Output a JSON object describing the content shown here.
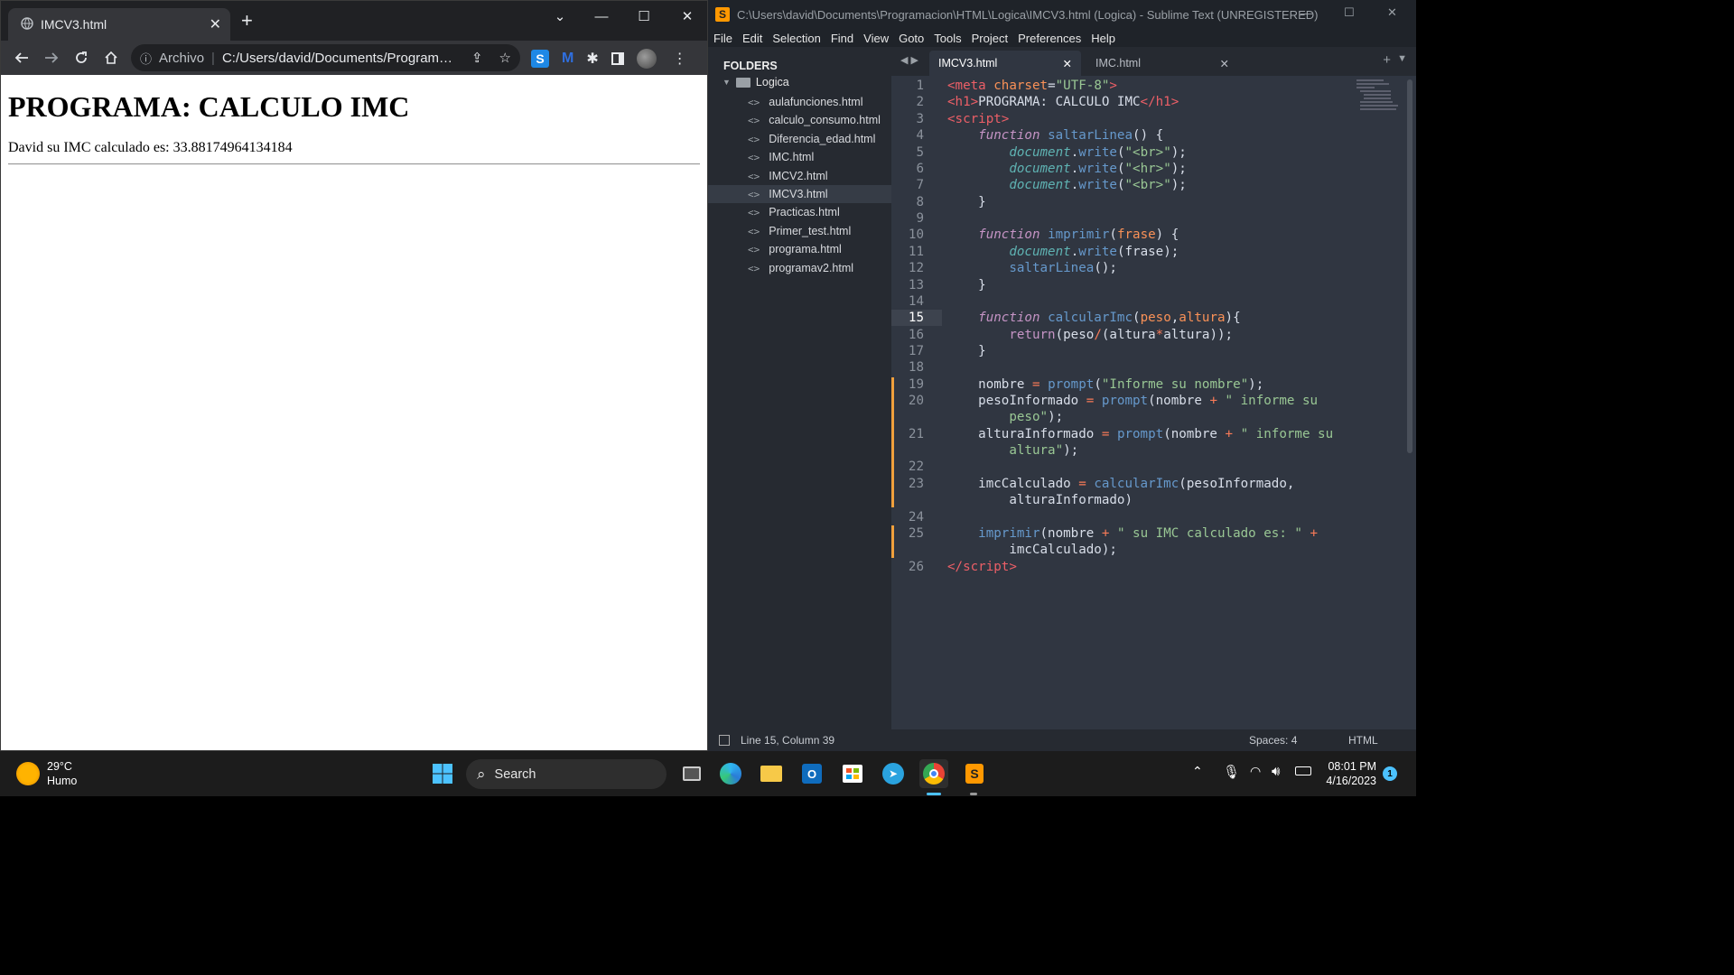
{
  "browser": {
    "tab_title": "IMCV3.html",
    "new_tab": "+",
    "addr_info": "Archivo",
    "url": "C:/Users/david/Documents/Programaci...",
    "heading": "PROGRAMA: CALCULO IMC",
    "result_text": "David su IMC calculado es: 33.88174964134184"
  },
  "sublime": {
    "title": "C:\\Users\\david\\Documents\\Programacion\\HTML\\Logica\\IMCV3.html (Logica) - Sublime Text (UNREGISTERED)",
    "menu": [
      "File",
      "Edit",
      "Selection",
      "Find",
      "View",
      "Goto",
      "Tools",
      "Project",
      "Preferences",
      "Help"
    ],
    "folders_header": "FOLDERS",
    "root_folder": "Logica",
    "files": [
      "aulafunciones.html",
      "calculo_consumo.html",
      "Diferencia_edad.html",
      "IMC.html",
      "IMCV2.html",
      "IMCV3.html",
      "Practicas.html",
      "Primer_test.html",
      "programa.html",
      "programav2.html"
    ],
    "tabs": [
      "IMCV3.html",
      "IMC.html"
    ],
    "status_pos": "Line 15, Column 39",
    "status_spaces": "Spaces: 4",
    "status_syntax": "HTML",
    "line_numbers": [
      "1",
      "2",
      "3",
      "4",
      "5",
      "6",
      "7",
      "8",
      "9",
      "10",
      "11",
      "12",
      "13",
      "14",
      "15",
      "16",
      "17",
      "18",
      "19",
      "20",
      "21",
      "22",
      "23",
      "24",
      "25",
      "26"
    ]
  },
  "taskbar": {
    "temp": "29°C",
    "weather": "Humo",
    "search": "Search",
    "time": "08:01 PM",
    "date": "4/16/2023",
    "badge": "1"
  }
}
